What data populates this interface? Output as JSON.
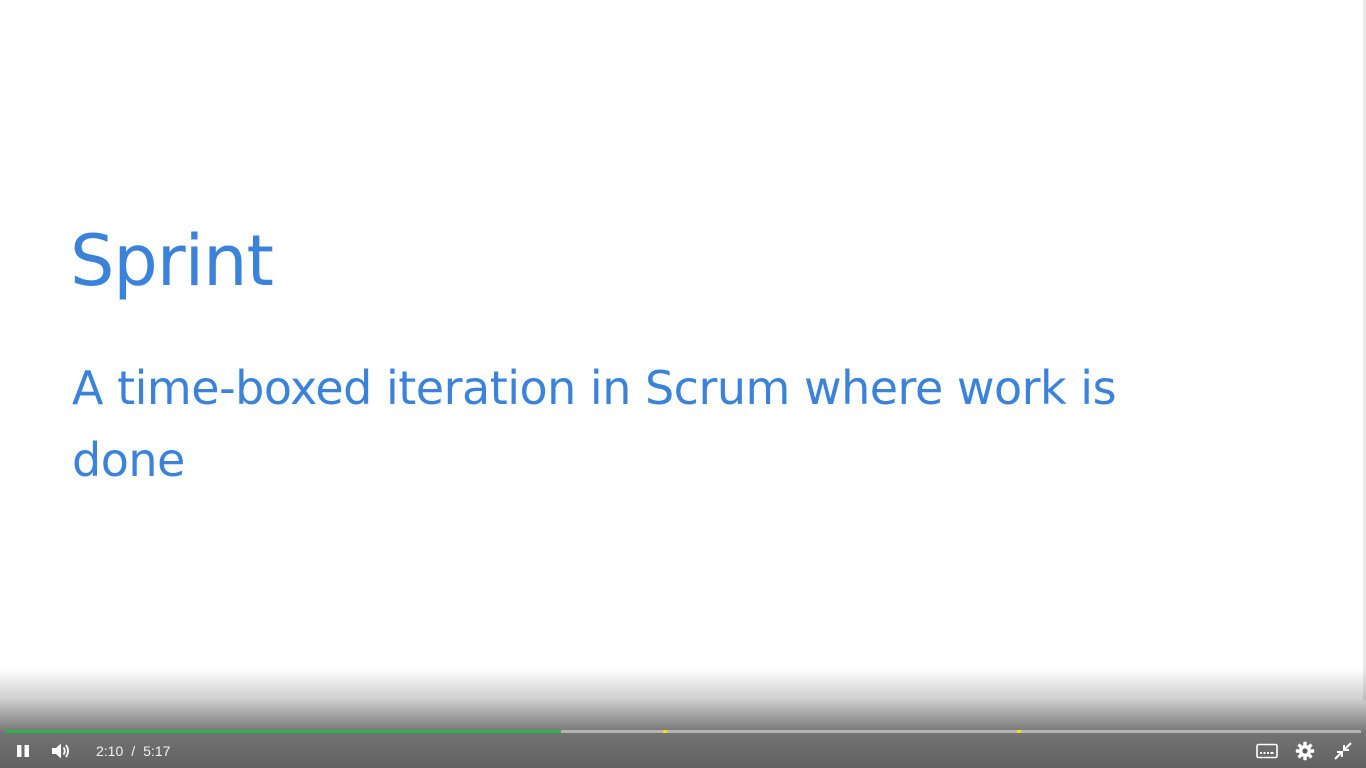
{
  "slide": {
    "title": "Sprint",
    "body": "A time-boxed iteration in Scrum where work is done"
  },
  "player": {
    "current_time": "2:10",
    "separator": "/",
    "duration": "5:17",
    "progress_fraction": 0.41,
    "chapter_markers": [
      0.487,
      0.748
    ],
    "colors": {
      "slide_text": "#3b82db",
      "played": "#2fb14a",
      "marker": "#f4e500"
    },
    "icons": {
      "play_pause": "pause-icon",
      "volume": "volume-icon",
      "captions": "captions-icon",
      "settings": "gear-icon",
      "fullscreen": "exit-fullscreen-icon"
    }
  }
}
